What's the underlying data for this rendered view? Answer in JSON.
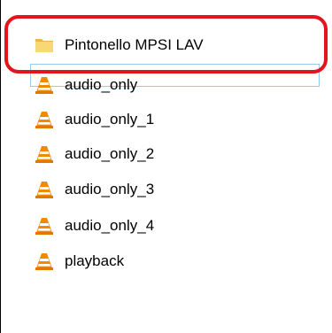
{
  "items": [
    {
      "label": "Pintonello MPSI LAV",
      "icon": "folder-icon",
      "type": "folder"
    },
    {
      "label": "audio_only",
      "icon": "vlc-media-file-icon",
      "type": "media"
    },
    {
      "label": "audio_only_1",
      "icon": "vlc-media-file-icon",
      "type": "media"
    },
    {
      "label": "audio_only_2",
      "icon": "vlc-media-file-icon",
      "type": "media"
    },
    {
      "label": "audio_only_3",
      "icon": "vlc-media-file-icon",
      "type": "media"
    },
    {
      "label": "audio_only_4",
      "icon": "vlc-media-file-icon",
      "type": "media"
    },
    {
      "label": "playback",
      "icon": "vlc-media-file-icon",
      "type": "media"
    }
  ],
  "colors": {
    "highlight_ring": "#e3141b",
    "focus_border": "#99c9ef",
    "folder": "#f8d775",
    "vlc_orange": "#f08a00"
  }
}
